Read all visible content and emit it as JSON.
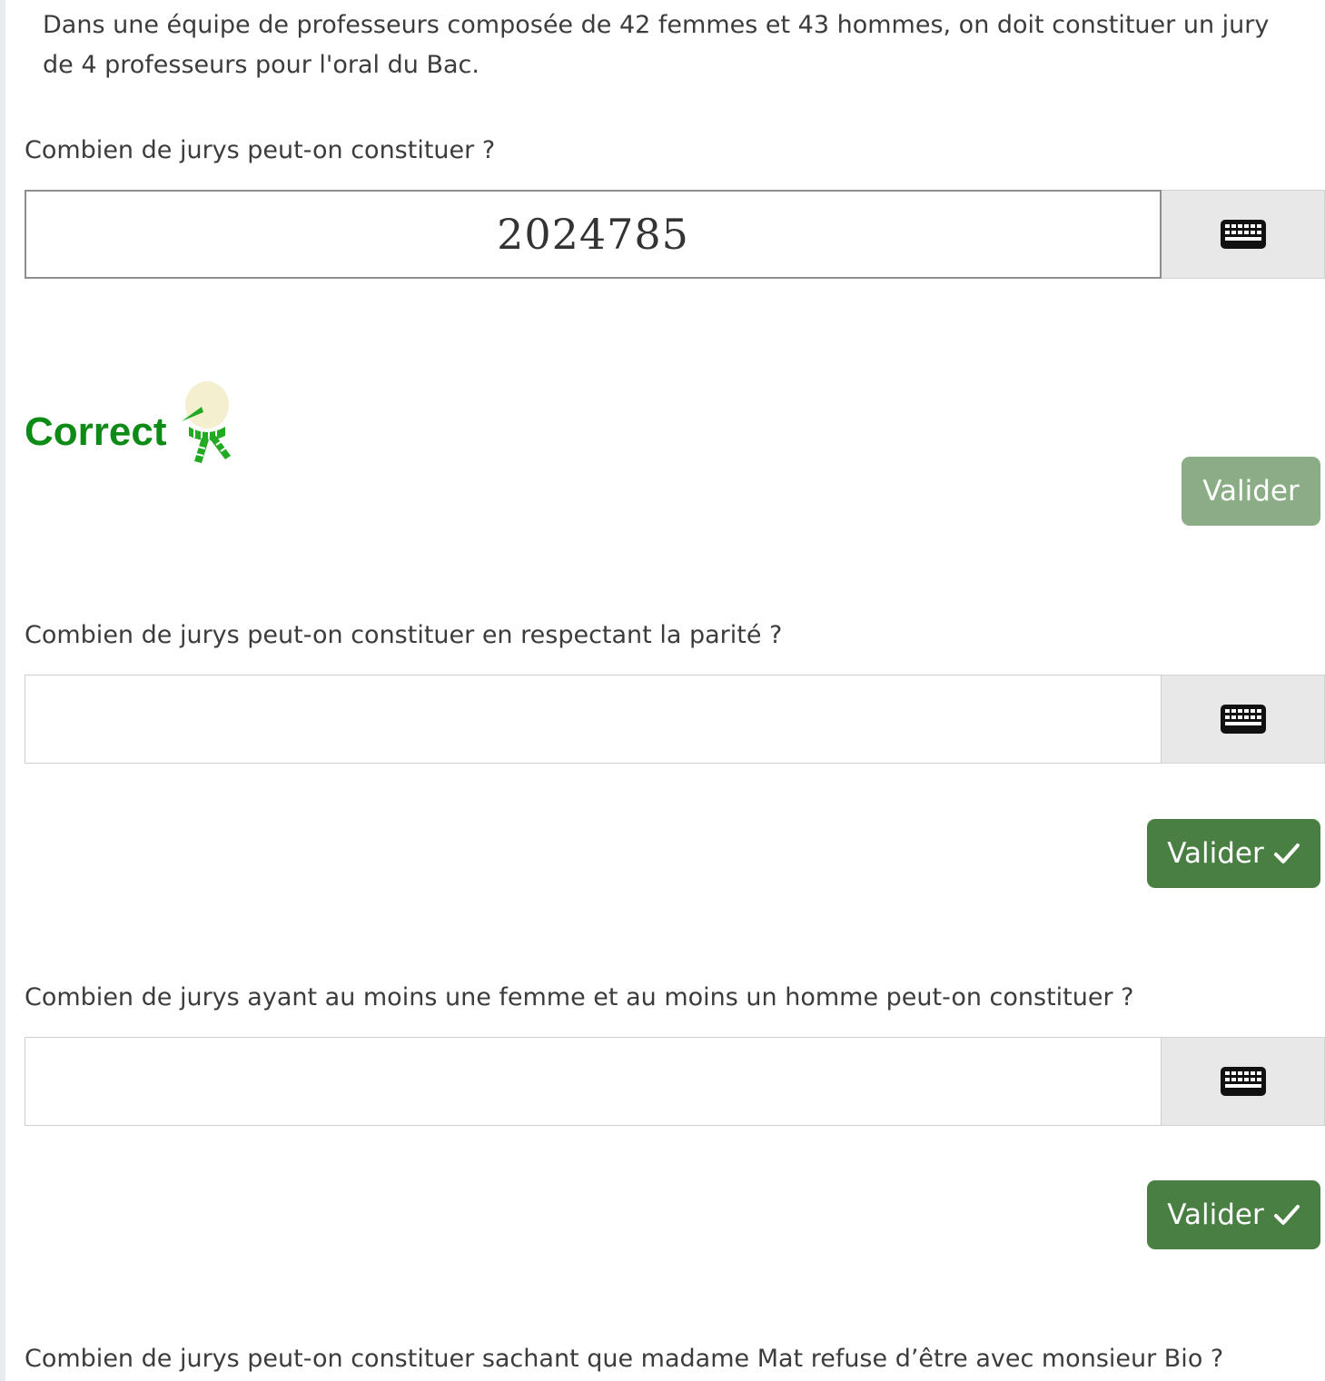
{
  "intro": "Dans une équipe de professeurs composée de 42 femmes et 43 hommes, on doit constituer un jury de 4 professeurs pour l'oral du Bac.",
  "questions": [
    {
      "text": "Combien de jurys peut-on constituer ?",
      "answer": "2024785",
      "feedback": "Correct",
      "validate_label": "Valider",
      "validate_state": "disabled"
    },
    {
      "text": "Combien de jurys peut-on constituer en respectant la parité ?",
      "answer": "",
      "validate_label": "Valider",
      "validate_state": "active"
    },
    {
      "text": "Combien de jurys ayant au moins une femme et au moins un homme peut-on constituer ?",
      "answer": "",
      "validate_label": "Valider",
      "validate_state": "active"
    },
    {
      "text": "Combien de jurys peut-on constituer sachant que madame Mat refuse d’être avec monsieur Bio ?"
    }
  ],
  "icons": {
    "keyboard": "keyboard-icon",
    "check": "check-icon",
    "mascot": "snowman-mascot-icon"
  },
  "colors": {
    "correct": "#0e8a16",
    "button_active": "#4a7f44",
    "button_disabled": "#8aad85",
    "mascot_scarf": "#22aa22",
    "mascot_head": "#f3efcf"
  }
}
